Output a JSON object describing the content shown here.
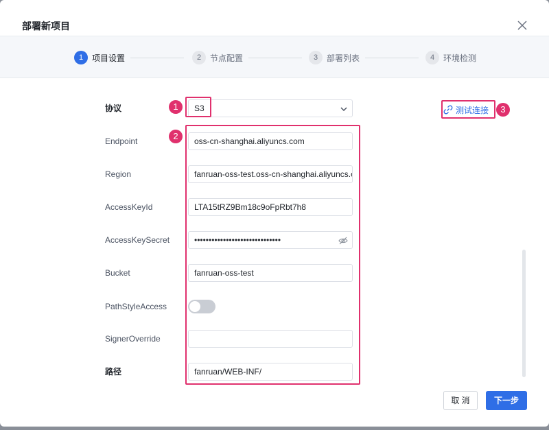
{
  "dialog": {
    "title": "部署新项目"
  },
  "steps": [
    {
      "num": "1",
      "label": "项目设置",
      "active": true
    },
    {
      "num": "2",
      "label": "节点配置",
      "active": false
    },
    {
      "num": "3",
      "label": "部署列表",
      "active": false
    },
    {
      "num": "4",
      "label": "环境检测",
      "active": false
    }
  ],
  "form": {
    "protocol": {
      "label": "协议",
      "value": "S3"
    },
    "endpoint": {
      "label": "Endpoint",
      "value": "oss-cn-shanghai.aliyuncs.com"
    },
    "region": {
      "label": "Region",
      "value": "fanruan-oss-test.oss-cn-shanghai.aliyuncs.com"
    },
    "access_key_id": {
      "label": "AccessKeyId",
      "value": "LTA15tRZ9Bm18c9oFpRbt7h8"
    },
    "access_key_secret": {
      "label": "AccessKeySecret",
      "value": "••••••••••••••••••••••••••••••"
    },
    "bucket": {
      "label": "Bucket",
      "value": "fanruan-oss-test"
    },
    "path_style_access": {
      "label": "PathStyleAccess",
      "enabled": false
    },
    "signer_override": {
      "label": "SignerOverride",
      "value": ""
    },
    "path": {
      "label": "路径",
      "value": "fanruan/WEB-INF/"
    }
  },
  "test_connection": {
    "label": "测试连接"
  },
  "annotations": {
    "badge1": "1",
    "badge2": "2",
    "badge3": "3"
  },
  "footer": {
    "cancel_label": "取 消",
    "next_label": "下一步"
  },
  "colors": {
    "primary": "#2f6ee6",
    "annotation": "#e0306d"
  }
}
